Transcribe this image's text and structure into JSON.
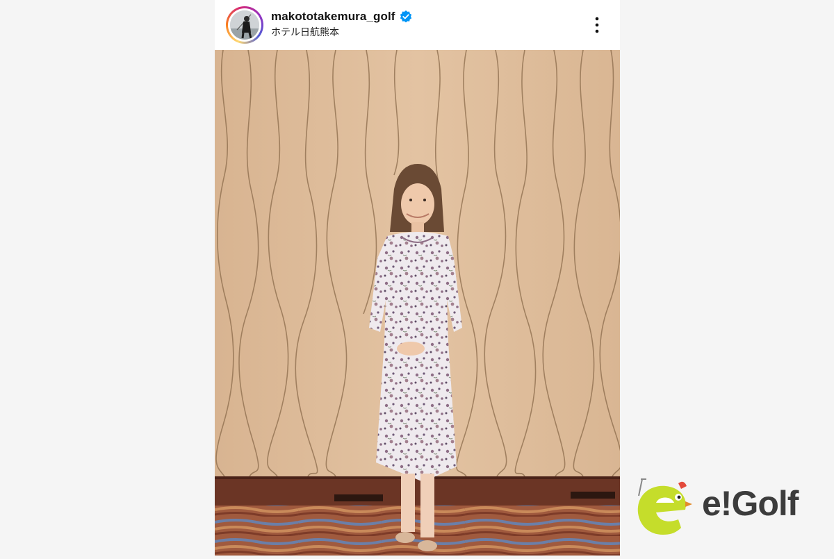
{
  "post": {
    "username": "makototakemura_golf",
    "location": "ホテル日航熊本",
    "verified": true
  },
  "brand": {
    "logo_text": "e!Golf"
  },
  "colors": {
    "verified_blue": "#0095f6",
    "logo_green": "#c5dd2b",
    "logo_gray": "#3c3c3c"
  },
  "icons": {
    "avatar": "profile-photo",
    "verified": "verified-badge-icon",
    "more": "more-options-icon"
  }
}
